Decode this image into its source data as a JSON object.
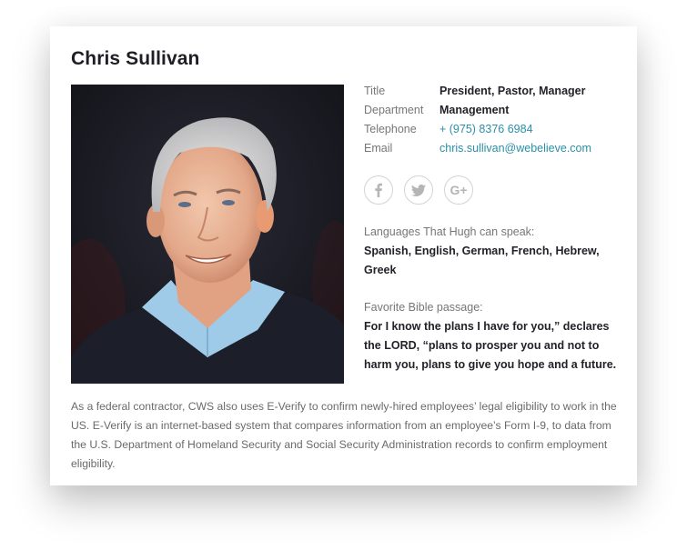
{
  "profile": {
    "name": "Chris Sullivan",
    "photo_alt": "Portrait of Chris Sullivan"
  },
  "details": [
    {
      "label": "Title",
      "value": "President, Pastor, Manager",
      "type": "text"
    },
    {
      "label": "Department",
      "value": "Management",
      "type": "text"
    },
    {
      "label": "Telephone",
      "value": "+ (975) 8376 6984",
      "type": "link"
    },
    {
      "label": "Email",
      "value": "chris.sullivan@webelieve.com",
      "type": "link"
    }
  ],
  "socials": [
    {
      "name": "facebook",
      "icon": "facebook-icon"
    },
    {
      "name": "twitter",
      "icon": "twitter-icon"
    },
    {
      "name": "google-plus",
      "icon": "google-plus-icon",
      "glyph": "G+"
    }
  ],
  "languages": {
    "caption": "Languages That Hugh can speak:",
    "value": "Spanish, English, German, French, Hebrew, Greek"
  },
  "bible": {
    "caption": "Favorite Bible passage:",
    "value": "For I know the plans I have for you,” declares the LORD, “plans to prosper you and not to harm you, plans to give you hope and a future."
  },
  "footer": {
    "text": "As a federal contractor, CWS also uses E-Verify to confirm newly-hired employees’ legal eligibility to work in the US. E-Verify is an internet-based system that compares information from an employee’s Form I-9, to data from the U.S. Department of Homeland Security and Social Security Administration records to confirm employment eligibility."
  },
  "colors": {
    "link": "#2a8fa8",
    "label": "#777777",
    "value": "#222228"
  }
}
